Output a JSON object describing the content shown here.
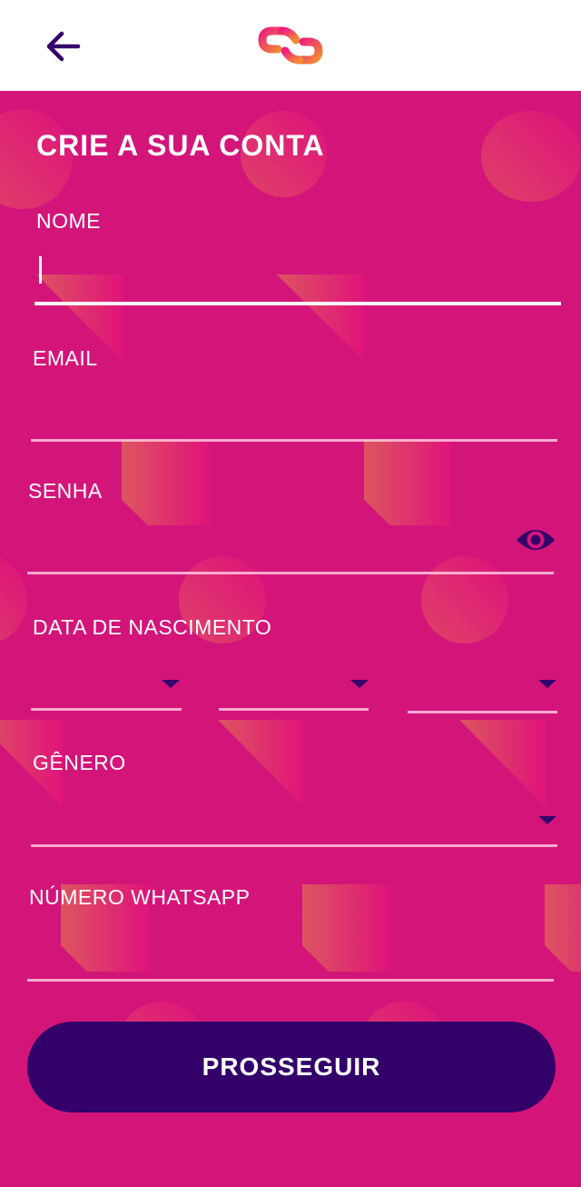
{
  "header": {
    "back_icon": "arrow-left-icon",
    "logo_icon": "chain-link-logo-icon"
  },
  "form": {
    "title": "CRIE A SUA CONTA",
    "nome_label": "NOME",
    "nome_value": "",
    "email_label": "EMAIL",
    "email_value": "",
    "senha_label": "SENHA",
    "senha_value": "",
    "senha_toggle_icon": "eye-icon",
    "nascimento_label": "DATA DE NASCIMENTO",
    "nascimento_day": "",
    "nascimento_month": "",
    "nascimento_year": "",
    "genero_label": "GÊNERO",
    "genero_value": "",
    "whatsapp_label": "NÚMERO WHATSAPP",
    "whatsapp_value": "",
    "submit_label": "PROSSEGUIR"
  },
  "colors": {
    "background": "#d3157a",
    "header_bg": "#ffffff",
    "button_bg": "#33006a",
    "icon_purple": "#34006b",
    "logo_pink": "#ee1f7e",
    "logo_orange": "#f28b33"
  }
}
